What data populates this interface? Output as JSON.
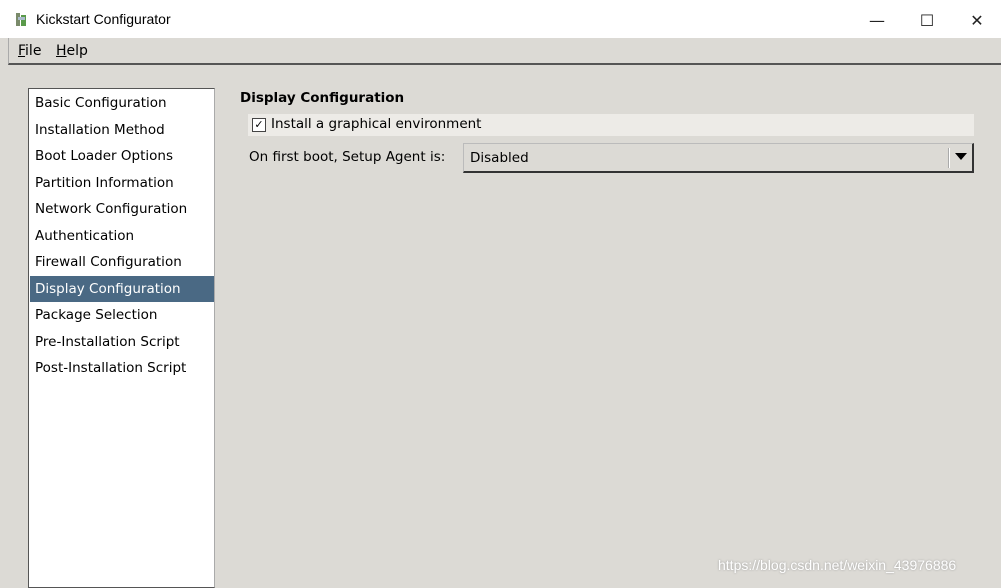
{
  "window": {
    "title": "Kickstart Configurator",
    "minimize": "—",
    "maximize": "☐",
    "close": "✕"
  },
  "menu": [
    {
      "label": "File",
      "mnemonic": "F",
      "rest": "ile"
    },
    {
      "label": "Help",
      "mnemonic": "H",
      "rest": "elp"
    }
  ],
  "sidebar": {
    "items": [
      {
        "label": "Basic Configuration"
      },
      {
        "label": "Installation Method"
      },
      {
        "label": "Boot Loader Options"
      },
      {
        "label": "Partition Information"
      },
      {
        "label": "Network Configuration"
      },
      {
        "label": "Authentication"
      },
      {
        "label": "Firewall Configuration"
      },
      {
        "label": "Display Configuration",
        "selected": true
      },
      {
        "label": "Package Selection"
      },
      {
        "label": "Pre-Installation Script"
      },
      {
        "label": "Post-Installation Script"
      }
    ],
    "selected_color": "#4a6984"
  },
  "main": {
    "heading": "Display Configuration",
    "graphical": {
      "label": "Install a graphical environment",
      "checked": true,
      "mark": "✓"
    },
    "setup_agent": {
      "label": "On first boot, Setup Agent is:",
      "value": "Disabled"
    }
  },
  "watermark": "https://blog.csdn.net/weixin_43976886"
}
